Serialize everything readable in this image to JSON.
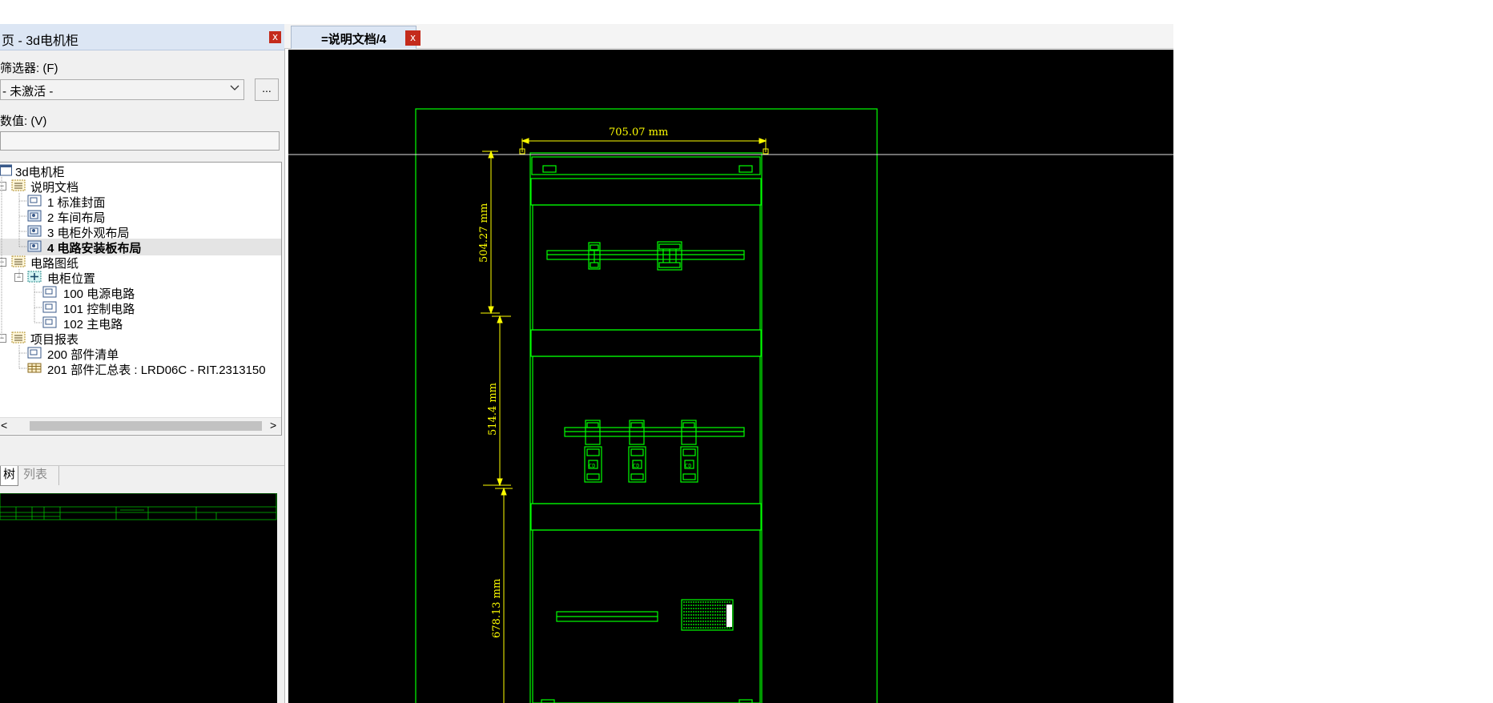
{
  "panel": {
    "title": "页 - 3d电机柜",
    "close_label": "x",
    "filter_label": "筛选器: (F)",
    "filter_value": "- 未激活 -",
    "more_label": "...",
    "value_label": "数值: (V)",
    "value_input": ""
  },
  "tree": {
    "root": "3d电机柜",
    "n1": "说明文档",
    "n1_1": "1 标准封面",
    "n1_2": "2 车间布局",
    "n1_3": "3 电柜外观布局",
    "n1_4": "4 电路安装板布局",
    "n2": "电路图纸",
    "n2_1": "电柜位置",
    "n2_1_1": "100 电源电路",
    "n2_1_2": "101 控制电路",
    "n2_1_3": "102 主电路",
    "n3": "项目报表",
    "n3_1": "200 部件清单",
    "n3_2": "201 部件汇总表 : LRD06C - RIT.2313150"
  },
  "scroll": {
    "left": "<",
    "right": ">"
  },
  "tabs": {
    "tree": "树",
    "list": "列表"
  },
  "doc": {
    "tab_label": "=说明文档/4",
    "close_label": "x"
  },
  "drawing": {
    "dim_width": "705.07 mm",
    "dim_h1": "504.27 mm",
    "dim_h2": "514.4 mm",
    "dim_h3": "678.13 mm",
    "comp_mark": "CD"
  },
  "colors": {
    "cad_green": "#00ff00",
    "cad_dim": "#ffff00",
    "canvas": "#000000",
    "close_red": "#c42b1c"
  }
}
